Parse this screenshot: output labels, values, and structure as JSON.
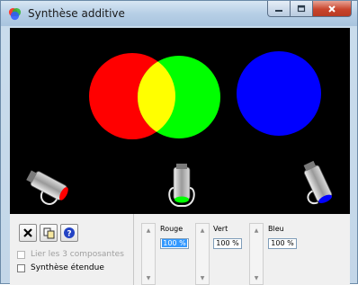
{
  "window": {
    "title": "Synthèse additive",
    "buttons": {
      "minimize_icon": "minimize-icon",
      "maximize_icon": "maximize-icon",
      "close_icon": "close-icon"
    }
  },
  "canvas": {
    "background": "#000000",
    "circles": [
      {
        "name": "red",
        "color": "#ff0000"
      },
      {
        "name": "green",
        "color": "#00ff00"
      },
      {
        "name": "blue",
        "color": "#0000ff"
      }
    ],
    "overlap_color": "#ffff00",
    "spotlights": [
      {
        "name": "red",
        "lens_color": "#ff0000"
      },
      {
        "name": "green",
        "lens_color": "#00ff00"
      },
      {
        "name": "blue",
        "lens_color": "#0000ff"
      }
    ]
  },
  "toolbar": {
    "buttons": [
      {
        "name": "close",
        "icon": "x-icon"
      },
      {
        "name": "copy",
        "icon": "copy-icon"
      },
      {
        "name": "help",
        "icon": "help-icon"
      }
    ]
  },
  "options": {
    "link_components": {
      "label": "Lier les 3 composantes",
      "checked": false,
      "enabled": false
    },
    "extended_synthesis": {
      "label": "Synthèse étendue",
      "checked": false,
      "enabled": true
    }
  },
  "channels": {
    "red": {
      "label": "Rouge",
      "value": "100 %",
      "selected": true
    },
    "green": {
      "label": "Vert",
      "value": "100 %",
      "selected": false
    },
    "blue": {
      "label": "Bleu",
      "value": "100 %",
      "selected": false
    }
  }
}
